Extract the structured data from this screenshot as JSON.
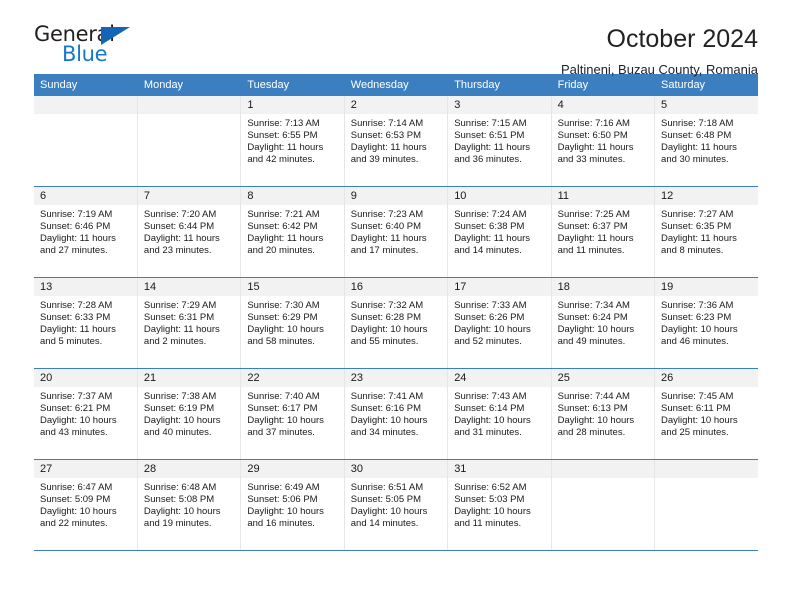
{
  "brand": {
    "name_top": "General",
    "name_bottom": "Blue",
    "accent_color": "#1878c8",
    "triangle_color": "#1565b5"
  },
  "header": {
    "title": "October 2024",
    "subtitle": "Paltineni, Buzau County, Romania"
  },
  "theme": {
    "header_row_bg": "#3c7fc1",
    "daynum_bg": "#f2f2f2",
    "row_separator": "#3c7fc1",
    "column_separator": "#e6e6e6",
    "text": "#1a1a1a"
  },
  "weekdays": [
    "Sunday",
    "Monday",
    "Tuesday",
    "Wednesday",
    "Thursday",
    "Friday",
    "Saturday"
  ],
  "weeks": [
    [
      {
        "day": "",
        "lines": []
      },
      {
        "day": "",
        "lines": []
      },
      {
        "day": "1",
        "lines": [
          "Sunrise: 7:13 AM",
          "Sunset: 6:55 PM",
          "Daylight: 11 hours and 42 minutes."
        ]
      },
      {
        "day": "2",
        "lines": [
          "Sunrise: 7:14 AM",
          "Sunset: 6:53 PM",
          "Daylight: 11 hours and 39 minutes."
        ]
      },
      {
        "day": "3",
        "lines": [
          "Sunrise: 7:15 AM",
          "Sunset: 6:51 PM",
          "Daylight: 11 hours and 36 minutes."
        ]
      },
      {
        "day": "4",
        "lines": [
          "Sunrise: 7:16 AM",
          "Sunset: 6:50 PM",
          "Daylight: 11 hours and 33 minutes."
        ]
      },
      {
        "day": "5",
        "lines": [
          "Sunrise: 7:18 AM",
          "Sunset: 6:48 PM",
          "Daylight: 11 hours and 30 minutes."
        ]
      }
    ],
    [
      {
        "day": "6",
        "lines": [
          "Sunrise: 7:19 AM",
          "Sunset: 6:46 PM",
          "Daylight: 11 hours and 27 minutes."
        ]
      },
      {
        "day": "7",
        "lines": [
          "Sunrise: 7:20 AM",
          "Sunset: 6:44 PM",
          "Daylight: 11 hours and 23 minutes."
        ]
      },
      {
        "day": "8",
        "lines": [
          "Sunrise: 7:21 AM",
          "Sunset: 6:42 PM",
          "Daylight: 11 hours and 20 minutes."
        ]
      },
      {
        "day": "9",
        "lines": [
          "Sunrise: 7:23 AM",
          "Sunset: 6:40 PM",
          "Daylight: 11 hours and 17 minutes."
        ]
      },
      {
        "day": "10",
        "lines": [
          "Sunrise: 7:24 AM",
          "Sunset: 6:38 PM",
          "Daylight: 11 hours and 14 minutes."
        ]
      },
      {
        "day": "11",
        "lines": [
          "Sunrise: 7:25 AM",
          "Sunset: 6:37 PM",
          "Daylight: 11 hours and 11 minutes."
        ]
      },
      {
        "day": "12",
        "lines": [
          "Sunrise: 7:27 AM",
          "Sunset: 6:35 PM",
          "Daylight: 11 hours and 8 minutes."
        ]
      }
    ],
    [
      {
        "day": "13",
        "lines": [
          "Sunrise: 7:28 AM",
          "Sunset: 6:33 PM",
          "Daylight: 11 hours and 5 minutes."
        ]
      },
      {
        "day": "14",
        "lines": [
          "Sunrise: 7:29 AM",
          "Sunset: 6:31 PM",
          "Daylight: 11 hours and 2 minutes."
        ]
      },
      {
        "day": "15",
        "lines": [
          "Sunrise: 7:30 AM",
          "Sunset: 6:29 PM",
          "Daylight: 10 hours and 58 minutes."
        ]
      },
      {
        "day": "16",
        "lines": [
          "Sunrise: 7:32 AM",
          "Sunset: 6:28 PM",
          "Daylight: 10 hours and 55 minutes."
        ]
      },
      {
        "day": "17",
        "lines": [
          "Sunrise: 7:33 AM",
          "Sunset: 6:26 PM",
          "Daylight: 10 hours and 52 minutes."
        ]
      },
      {
        "day": "18",
        "lines": [
          "Sunrise: 7:34 AM",
          "Sunset: 6:24 PM",
          "Daylight: 10 hours and 49 minutes."
        ]
      },
      {
        "day": "19",
        "lines": [
          "Sunrise: 7:36 AM",
          "Sunset: 6:23 PM",
          "Daylight: 10 hours and 46 minutes."
        ]
      }
    ],
    [
      {
        "day": "20",
        "lines": [
          "Sunrise: 7:37 AM",
          "Sunset: 6:21 PM",
          "Daylight: 10 hours and 43 minutes."
        ]
      },
      {
        "day": "21",
        "lines": [
          "Sunrise: 7:38 AM",
          "Sunset: 6:19 PM",
          "Daylight: 10 hours and 40 minutes."
        ]
      },
      {
        "day": "22",
        "lines": [
          "Sunrise: 7:40 AM",
          "Sunset: 6:17 PM",
          "Daylight: 10 hours and 37 minutes."
        ]
      },
      {
        "day": "23",
        "lines": [
          "Sunrise: 7:41 AM",
          "Sunset: 6:16 PM",
          "Daylight: 10 hours and 34 minutes."
        ]
      },
      {
        "day": "24",
        "lines": [
          "Sunrise: 7:43 AM",
          "Sunset: 6:14 PM",
          "Daylight: 10 hours and 31 minutes."
        ]
      },
      {
        "day": "25",
        "lines": [
          "Sunrise: 7:44 AM",
          "Sunset: 6:13 PM",
          "Daylight: 10 hours and 28 minutes."
        ]
      },
      {
        "day": "26",
        "lines": [
          "Sunrise: 7:45 AM",
          "Sunset: 6:11 PM",
          "Daylight: 10 hours and 25 minutes."
        ]
      }
    ],
    [
      {
        "day": "27",
        "lines": [
          "Sunrise: 6:47 AM",
          "Sunset: 5:09 PM",
          "Daylight: 10 hours and 22 minutes."
        ]
      },
      {
        "day": "28",
        "lines": [
          "Sunrise: 6:48 AM",
          "Sunset: 5:08 PM",
          "Daylight: 10 hours and 19 minutes."
        ]
      },
      {
        "day": "29",
        "lines": [
          "Sunrise: 6:49 AM",
          "Sunset: 5:06 PM",
          "Daylight: 10 hours and 16 minutes."
        ]
      },
      {
        "day": "30",
        "lines": [
          "Sunrise: 6:51 AM",
          "Sunset: 5:05 PM",
          "Daylight: 10 hours and 14 minutes."
        ]
      },
      {
        "day": "31",
        "lines": [
          "Sunrise: 6:52 AM",
          "Sunset: 5:03 PM",
          "Daylight: 10 hours and 11 minutes."
        ]
      },
      {
        "day": "",
        "lines": []
      },
      {
        "day": "",
        "lines": []
      }
    ]
  ]
}
